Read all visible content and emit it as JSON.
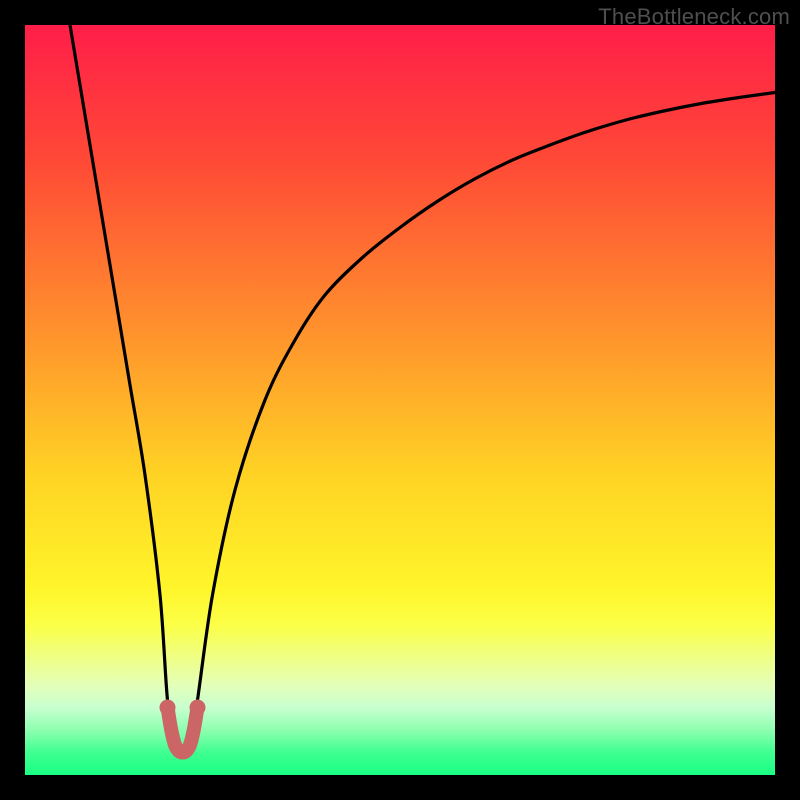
{
  "watermark": {
    "text": "TheBottleneck.com"
  },
  "gradient": {
    "stops": [
      {
        "pct": 0,
        "color": "#ff1e49"
      },
      {
        "pct": 18,
        "color": "#ff4936"
      },
      {
        "pct": 40,
        "color": "#ff8f2d"
      },
      {
        "pct": 60,
        "color": "#ffd324"
      },
      {
        "pct": 75,
        "color": "#fff52a"
      },
      {
        "pct": 80,
        "color": "#fbff47"
      },
      {
        "pct": 84,
        "color": "#f0ff80"
      },
      {
        "pct": 88,
        "color": "#e4ffb8"
      },
      {
        "pct": 91,
        "color": "#c8ffd0"
      },
      {
        "pct": 94,
        "color": "#8effb0"
      },
      {
        "pct": 97,
        "color": "#3eff91"
      },
      {
        "pct": 100,
        "color": "#1aff84"
      }
    ]
  },
  "chart_data": {
    "type": "line",
    "title": "",
    "xlabel": "",
    "ylabel": "",
    "xlim": [
      0,
      100
    ],
    "ylim": [
      0,
      100
    ],
    "series": [
      {
        "name": "bottleneck-curve",
        "x": [
          6,
          8,
          10,
          12,
          14,
          16,
          18,
          19,
          20,
          21,
          22,
          23,
          25,
          28,
          32,
          36,
          40,
          45,
          50,
          55,
          60,
          65,
          70,
          75,
          80,
          85,
          90,
          95,
          100
        ],
        "values": [
          100,
          88,
          76,
          64,
          52,
          40,
          24,
          10,
          4,
          3,
          4,
          10,
          24,
          38,
          50,
          58,
          64,
          69,
          73,
          76.5,
          79.5,
          82,
          84,
          85.8,
          87.3,
          88.5,
          89.5,
          90.3,
          91
        ]
      }
    ],
    "highlight": {
      "name": "optimal-range",
      "color": "#cc6666",
      "points": [
        {
          "x": 19.0,
          "y": 9
        },
        {
          "x": 19.5,
          "y": 6
        },
        {
          "x": 20.0,
          "y": 4
        },
        {
          "x": 20.5,
          "y": 3.2
        },
        {
          "x": 21.0,
          "y": 3
        },
        {
          "x": 21.5,
          "y": 3.2
        },
        {
          "x": 22.0,
          "y": 4
        },
        {
          "x": 22.5,
          "y": 6
        },
        {
          "x": 23.0,
          "y": 9
        }
      ]
    }
  }
}
